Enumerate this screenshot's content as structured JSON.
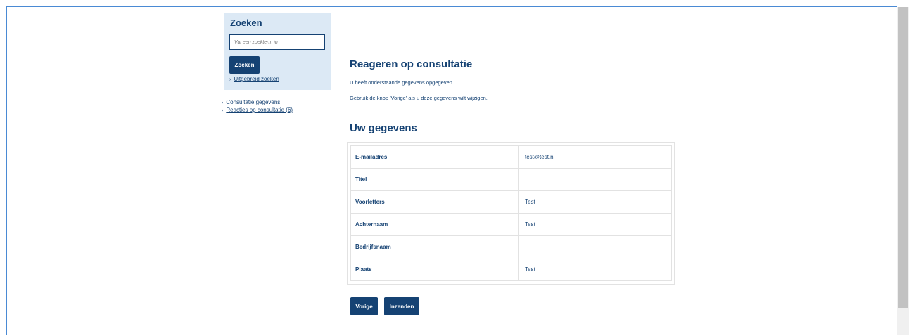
{
  "search": {
    "title": "Zoeken",
    "placeholder": "Vul een zoekterm in",
    "button_label": "Zoeken",
    "advanced_link": "Uitgebreid zoeken"
  },
  "sidenav": {
    "items": [
      {
        "label": "Consultatie gegevens"
      },
      {
        "label": "Reacties op consultatie (6)"
      }
    ]
  },
  "main": {
    "title": "Reageren op consultatie",
    "intro_1": "U heeft onderstaande gegevens opgegeven.",
    "intro_2": "Gebruik de knop 'Vorige' als u deze gegevens wilt wijzigen.",
    "section_title": "Uw gegevens",
    "rows": [
      {
        "label": "E-mailadres",
        "value": "test@test.nl"
      },
      {
        "label": "Titel",
        "value": ""
      },
      {
        "label": "Voorletters",
        "value": "Test"
      },
      {
        "label": "Achternaam",
        "value": "Test"
      },
      {
        "label": "Bedrijfsnaam",
        "value": ""
      },
      {
        "label": "Plaats",
        "value": "Test"
      }
    ],
    "buttons": {
      "previous": "Vorige",
      "submit": "Inzenden"
    }
  },
  "icons": {
    "chevron": "chevron-right-icon"
  },
  "colors": {
    "primary": "#154273",
    "panel_bg": "#dce9f5",
    "frame": "#4a8ad4"
  }
}
